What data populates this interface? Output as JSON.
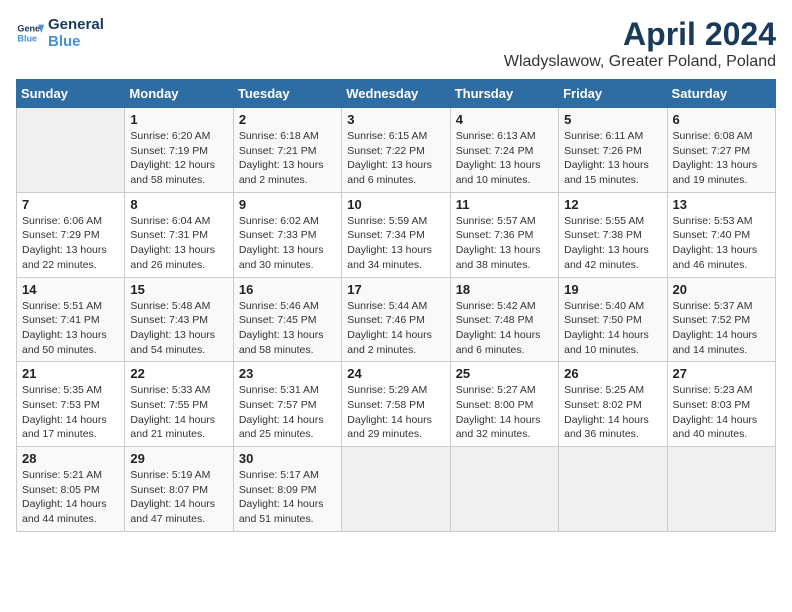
{
  "header": {
    "logo_line1": "General",
    "logo_line2": "Blue",
    "title": "April 2024",
    "subtitle": "Wladyslawow, Greater Poland, Poland"
  },
  "columns": [
    "Sunday",
    "Monday",
    "Tuesday",
    "Wednesday",
    "Thursday",
    "Friday",
    "Saturday"
  ],
  "weeks": [
    [
      {
        "day": "",
        "info": ""
      },
      {
        "day": "1",
        "info": "Sunrise: 6:20 AM\nSunset: 7:19 PM\nDaylight: 12 hours\nand 58 minutes."
      },
      {
        "day": "2",
        "info": "Sunrise: 6:18 AM\nSunset: 7:21 PM\nDaylight: 13 hours\nand 2 minutes."
      },
      {
        "day": "3",
        "info": "Sunrise: 6:15 AM\nSunset: 7:22 PM\nDaylight: 13 hours\nand 6 minutes."
      },
      {
        "day": "4",
        "info": "Sunrise: 6:13 AM\nSunset: 7:24 PM\nDaylight: 13 hours\nand 10 minutes."
      },
      {
        "day": "5",
        "info": "Sunrise: 6:11 AM\nSunset: 7:26 PM\nDaylight: 13 hours\nand 15 minutes."
      },
      {
        "day": "6",
        "info": "Sunrise: 6:08 AM\nSunset: 7:27 PM\nDaylight: 13 hours\nand 19 minutes."
      }
    ],
    [
      {
        "day": "7",
        "info": "Sunrise: 6:06 AM\nSunset: 7:29 PM\nDaylight: 13 hours\nand 22 minutes."
      },
      {
        "day": "8",
        "info": "Sunrise: 6:04 AM\nSunset: 7:31 PM\nDaylight: 13 hours\nand 26 minutes."
      },
      {
        "day": "9",
        "info": "Sunrise: 6:02 AM\nSunset: 7:33 PM\nDaylight: 13 hours\nand 30 minutes."
      },
      {
        "day": "10",
        "info": "Sunrise: 5:59 AM\nSunset: 7:34 PM\nDaylight: 13 hours\nand 34 minutes."
      },
      {
        "day": "11",
        "info": "Sunrise: 5:57 AM\nSunset: 7:36 PM\nDaylight: 13 hours\nand 38 minutes."
      },
      {
        "day": "12",
        "info": "Sunrise: 5:55 AM\nSunset: 7:38 PM\nDaylight: 13 hours\nand 42 minutes."
      },
      {
        "day": "13",
        "info": "Sunrise: 5:53 AM\nSunset: 7:40 PM\nDaylight: 13 hours\nand 46 minutes."
      }
    ],
    [
      {
        "day": "14",
        "info": "Sunrise: 5:51 AM\nSunset: 7:41 PM\nDaylight: 13 hours\nand 50 minutes."
      },
      {
        "day": "15",
        "info": "Sunrise: 5:48 AM\nSunset: 7:43 PM\nDaylight: 13 hours\nand 54 minutes."
      },
      {
        "day": "16",
        "info": "Sunrise: 5:46 AM\nSunset: 7:45 PM\nDaylight: 13 hours\nand 58 minutes."
      },
      {
        "day": "17",
        "info": "Sunrise: 5:44 AM\nSunset: 7:46 PM\nDaylight: 14 hours\nand 2 minutes."
      },
      {
        "day": "18",
        "info": "Sunrise: 5:42 AM\nSunset: 7:48 PM\nDaylight: 14 hours\nand 6 minutes."
      },
      {
        "day": "19",
        "info": "Sunrise: 5:40 AM\nSunset: 7:50 PM\nDaylight: 14 hours\nand 10 minutes."
      },
      {
        "day": "20",
        "info": "Sunrise: 5:37 AM\nSunset: 7:52 PM\nDaylight: 14 hours\nand 14 minutes."
      }
    ],
    [
      {
        "day": "21",
        "info": "Sunrise: 5:35 AM\nSunset: 7:53 PM\nDaylight: 14 hours\nand 17 minutes."
      },
      {
        "day": "22",
        "info": "Sunrise: 5:33 AM\nSunset: 7:55 PM\nDaylight: 14 hours\nand 21 minutes."
      },
      {
        "day": "23",
        "info": "Sunrise: 5:31 AM\nSunset: 7:57 PM\nDaylight: 14 hours\nand 25 minutes."
      },
      {
        "day": "24",
        "info": "Sunrise: 5:29 AM\nSunset: 7:58 PM\nDaylight: 14 hours\nand 29 minutes."
      },
      {
        "day": "25",
        "info": "Sunrise: 5:27 AM\nSunset: 8:00 PM\nDaylight: 14 hours\nand 32 minutes."
      },
      {
        "day": "26",
        "info": "Sunrise: 5:25 AM\nSunset: 8:02 PM\nDaylight: 14 hours\nand 36 minutes."
      },
      {
        "day": "27",
        "info": "Sunrise: 5:23 AM\nSunset: 8:03 PM\nDaylight: 14 hours\nand 40 minutes."
      }
    ],
    [
      {
        "day": "28",
        "info": "Sunrise: 5:21 AM\nSunset: 8:05 PM\nDaylight: 14 hours\nand 44 minutes."
      },
      {
        "day": "29",
        "info": "Sunrise: 5:19 AM\nSunset: 8:07 PM\nDaylight: 14 hours\nand 47 minutes."
      },
      {
        "day": "30",
        "info": "Sunrise: 5:17 AM\nSunset: 8:09 PM\nDaylight: 14 hours\nand 51 minutes."
      },
      {
        "day": "",
        "info": ""
      },
      {
        "day": "",
        "info": ""
      },
      {
        "day": "",
        "info": ""
      },
      {
        "day": "",
        "info": ""
      }
    ]
  ]
}
